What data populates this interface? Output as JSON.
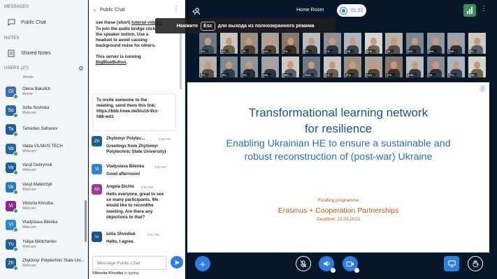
{
  "sidebar": {
    "messages_title": "MESSAGES",
    "public_chat": "Public Chat",
    "notes_title": "NOTES",
    "shared_notes": "Shared Notes",
    "users_title": "USERS (27)",
    "users": [
      {
        "initials": "Ol",
        "name": "Olena Bakulich",
        "status": "Mobile",
        "color": "#3d6db4"
      },
      {
        "initials": "So",
        "name": "Sofia Novitska",
        "status": "Webcam",
        "color": "#2b6aa6"
      },
      {
        "initials": "Ta",
        "name": "Tamerlan Safranov",
        "status": "",
        "color": "#1f5d9a"
      },
      {
        "initials": "Va",
        "name": "Vaida VILNIUS TECH",
        "status": "Webcam",
        "color": "#2465a8"
      },
      {
        "initials": "Va",
        "name": "Vasyl Debryniuk",
        "status": "Webcam",
        "color": "#1d5fa4"
      },
      {
        "initials": "Va",
        "name": "Vasyl Matelchyk",
        "status": "Webcam",
        "color": "#2b78c2"
      },
      {
        "initials": "Vi",
        "name": "Viktoriia Khrutba",
        "status": "Webcam",
        "color": "#8a2a8f"
      },
      {
        "initials": "Vl",
        "name": "Vladyslava Bilenka",
        "status": "Webcam",
        "color": "#2f84d6"
      },
      {
        "initials": "Yu",
        "name": "Yuliya Nikitchenko",
        "status": "Webcam",
        "color": "#24609f"
      },
      {
        "initials": "Zh",
        "name": "Zhytomyr Polytechnic State Uni...",
        "status": "Webcam",
        "color": "#1f5f8f"
      }
    ]
  },
  "chat": {
    "title": "Public Chat",
    "welcome_line1_pre": "see these (short) ",
    "welcome_link": "tutorial videos",
    "welcome_lines": [
      "To join the audio bridge click",
      "the speaker button.  Use a",
      "headset to avoid causing",
      "background noise for others."
    ],
    "server_line": "This server is running",
    "server_link": "BigBlueButton",
    "invite_lines": [
      "To invite someone to the",
      "meeting, send them this link:",
      "https://bbb.hnee.de/b/u16-9vz-",
      "h86-wd1"
    ],
    "messages": [
      {
        "initials": "Zh",
        "color": "#1f5f8f",
        "name": "Zhytomyr Polytec...",
        "time": "3:00 PM",
        "lines": [
          "Greetings from Zhytomyr",
          "Polytechnic State University)"
        ]
      },
      {
        "initials": "Vl",
        "color": "#2f84d6",
        "name": "Vladyslava Bilenka",
        "time": "3:00 PM",
        "lines": [
          "Good afternoon!"
        ]
      },
      {
        "initials": "An",
        "color": "#9a3d95",
        "name": "Angela Dichte",
        "time": "3:01 PM",
        "lines": [
          "Hello everyone, great to see",
          "so many participants. We",
          "would like to recordthe",
          "meeting. Are there any",
          "objections to that?"
        ]
      },
      {
        "initials": "Iu",
        "color": "#1e4f87",
        "name": "Iuliia Shvediuk",
        "time": "3:04 PM",
        "lines": [
          "Hello, I agree."
        ]
      }
    ],
    "input_placeholder": "Message Public Chat",
    "typing_name": "Viktoriia Khrutba",
    "typing_text": " is typing"
  },
  "topbar": {
    "room_title": "Home Room",
    "timer": "01:22"
  },
  "overlay": {
    "pre": "Нажмите",
    "key": "Esc",
    "post": "для выхода из полноэкранного режима"
  },
  "videos": [
    {
      "label": "Ga..."
    },
    {
      "label": "An..."
    },
    {
      "label": "Ali..."
    },
    {
      "label": "Aus..."
    },
    {
      "label": "Da..."
    },
    {
      "label": "Ele..."
    },
    {
      "label": "Fre..."
    },
    {
      "label": "Gal..."
    },
    {
      "label": "Gue..."
    },
    {
      "label": "Iul..."
    },
    {
      "label": "Kat..."
    },
    {
      "label": "Mar..."
    },
    {
      "label": "Nat..."
    },
    {
      "label": "Ro..."
    },
    {
      "label": "Tet..."
    },
    {
      "label": "Vai..."
    },
    {
      "label": "Via..."
    },
    {
      "label": "Vas..."
    },
    {
      "label": "Vas..."
    },
    {
      "label": "Vlad..."
    },
    {
      "label": "Yul..."
    },
    {
      "label": "Zhy..."
    },
    {
      "label": "Ana..."
    },
    {
      "label": "Em..."
    },
    {
      "label": "Gab..."
    },
    {
      "label": "Ha..."
    },
    {
      "label": "Phi..."
    },
    {
      "label": "Ste..."
    }
  ],
  "slide": {
    "title_line1": "Transformational learning network",
    "title_line2": "for resilience",
    "sub_line1": "Enabling Ukrainian HE to ensure a sustainable and",
    "sub_line2": "robust reconstruction of (post-war) Ukraine",
    "funding": "Funding programme",
    "programme": "Erasmus + Cooperation Partnerships",
    "deadline": "Deadline: 22.03.2023"
  },
  "colors": {
    "accent": "#2f7de1",
    "dark_bg": "#06172a",
    "slide_title": "#1f4e8c",
    "slide_sub": "#2a6fbf",
    "slide_orange": "#b25a17"
  }
}
